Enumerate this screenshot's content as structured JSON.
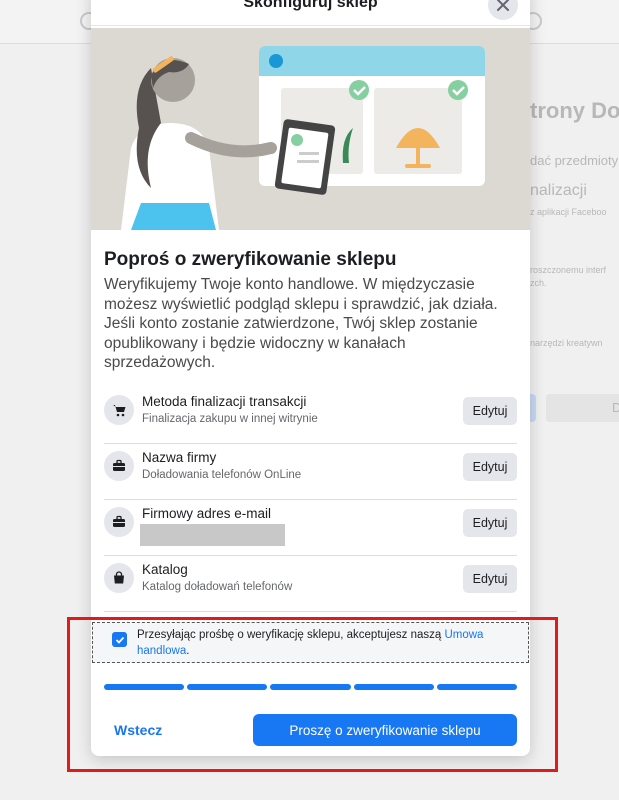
{
  "background": {
    "fragments": [
      "trony Do",
      "dać przedmioty",
      "nalizacji",
      "z aplikacji Faceboo",
      "roszczonemu interf",
      "zch.",
      "narzędzi kreatywn",
      "D"
    ]
  },
  "modal": {
    "title": "Skonfiguruj sklep",
    "heading": "Poproś o zweryfikowanie sklepu",
    "description": "Weryfikujemy Twoje konto handlowe. W międzyczasie możesz wyświetlić podgląd sklepu i sprawdzić, jak działa. Jeśli konto zostanie zatwierdzone, Twój sklep zostanie opublikowany i będzie widoczny w kanałach sprzedażowych.",
    "rows": [
      {
        "icon": "cart-icon",
        "title": "Metoda finalizacji transakcji",
        "subtitle": "Finalizacja zakupu w innej witrynie",
        "button": "Edytuj"
      },
      {
        "icon": "briefcase-icon",
        "title": "Nazwa firmy",
        "subtitle": "Doładowania telefonów OnLine",
        "button": "Edytuj"
      },
      {
        "icon": "briefcase-icon",
        "title": "Firmowy adres e-mail",
        "subtitle": "",
        "button": "Edytuj"
      },
      {
        "icon": "shopping-bag-icon",
        "title": "Katalog",
        "subtitle": "Katalog doładowań telefonów",
        "button": "Edytuj"
      }
    ],
    "consent": {
      "checked": true,
      "text": "Przesyłając prośbę o weryfikację sklepu, akceptujesz naszą ",
      "link": "Umowa handlowa",
      "suffix": "."
    },
    "progress": {
      "steps_total": 5,
      "steps_complete": 5
    },
    "back_label": "Wstecz",
    "submit_label": "Proszę o zweryfikowanie sklepu"
  },
  "colors": {
    "accent": "#1877f2",
    "highlight": "#e01b1b"
  }
}
